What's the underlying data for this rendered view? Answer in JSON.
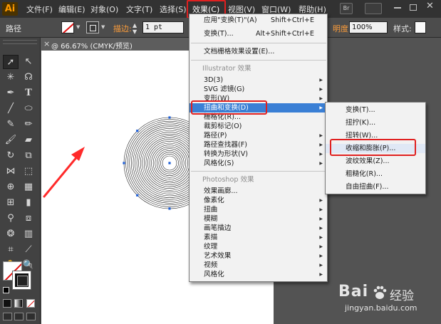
{
  "app": {
    "logo": "Ai"
  },
  "menubar": {
    "items": [
      "文件(F)",
      "编辑(E)",
      "对象(O)",
      "文字(T)",
      "选择(S)",
      "效果(C)",
      "视图(V)",
      "窗口(W)",
      "帮助(H)"
    ],
    "bridge_label": "Br"
  },
  "controlbar": {
    "selection_label": "路径",
    "stroke_label": "描边:",
    "stroke_value": "1 pt",
    "opacity_label": "明度:",
    "opacity_value": "100%",
    "style_label": "样式:"
  },
  "document": {
    "tab_title": "@ 66.67% (CMYK/预览)"
  },
  "effect_menu": {
    "apply_label": "应用\"变换(T)\"(A)",
    "apply_shortcut": "Shift+Ctrl+E",
    "transform_label": "变换(T)...",
    "transform_shortcut": "Alt+Shift+Ctrl+E",
    "raster_settings_label": "文档栅格效果设置(E)...",
    "illustrator_header": "Illustrator 效果",
    "illustrator_items": [
      "3D(3)",
      "SVG 滤镜(G)",
      "变形(W)",
      "扭曲和变换(D)",
      "栅格化(R)...",
      "裁剪标记(O)",
      "路径(P)",
      "路径查找器(F)",
      "转换为形状(V)",
      "风格化(S)"
    ],
    "photoshop_header": "Photoshop 效果",
    "photoshop_items": [
      "效果画廊...",
      "像素化",
      "扭曲",
      "模糊",
      "画笔描边",
      "素描",
      "纹理",
      "艺术效果",
      "视频",
      "风格化"
    ]
  },
  "distort_submenu": {
    "items": [
      "变换(T)...",
      "扭拧(K)...",
      "扭转(W)...",
      "收缩和膨胀(P)...",
      "波纹效果(Z)...",
      "粗糙化(R)...",
      "自由扭曲(F)..."
    ]
  },
  "watermark": {
    "brand": "Bai",
    "brand_suffix": "经验",
    "url": "jingyan.baidu.com"
  },
  "colors": {
    "highlight": "#e02020",
    "selection": "#3a7fd5",
    "accent_label": "#ff9e3a",
    "circle_stroke": "#222222",
    "anchor": "#1f5fd6"
  },
  "artwork": {
    "ring_count": 22
  }
}
